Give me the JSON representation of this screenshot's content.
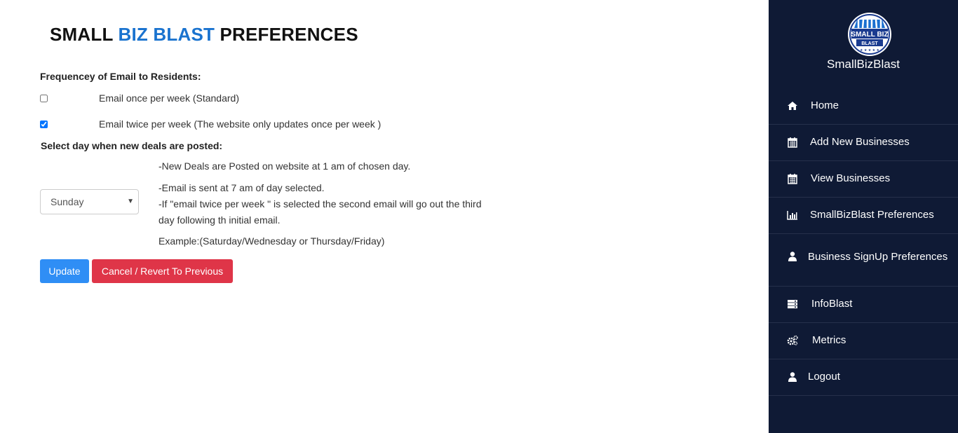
{
  "page": {
    "title_part1": "SMALL ",
    "title_accent": "BIZ BLAST",
    "title_part2": " PREFERENCES",
    "accent_color": "#1a73cf"
  },
  "frequency": {
    "label": "Frequencey of Email to Residents:",
    "options": [
      {
        "text": "Email once per week (Standard)",
        "checked": false
      },
      {
        "text": "Email twice per week (The website only updates once per week )",
        "checked": true
      }
    ]
  },
  "day": {
    "label": "Select day when new deals are posted:",
    "selected": "Sunday",
    "info": [
      "-New Deals are Posted on website at 1 am of chosen day.",
      "-Email is sent at 7 am of day selected.",
      "-If \"email twice per week \" is selected the second email will go out the third",
      "day following th initial email.",
      "Example:(Saturday/Wednesday or Thursday/Friday)"
    ]
  },
  "buttons": {
    "update": "Update",
    "cancel": "Cancel / Revert To Previous",
    "update_color": "#2f8ef5",
    "cancel_color": "#df3548"
  },
  "sidebar": {
    "brand": "SmallBizBlast",
    "logo_text_top": "SMALL BIZ",
    "logo_text_bottom": "BLAST",
    "background": "#0f1a35",
    "items": [
      {
        "label": "Home",
        "icon": "home-icon"
      },
      {
        "label": "Add New Businesses",
        "icon": "calendar-icon"
      },
      {
        "label": "View Businesses",
        "icon": "calendar-icon"
      },
      {
        "label": "SmallBizBlast Preferences",
        "icon": "bar-chart-icon"
      },
      {
        "label": "Business SignUp Preferences",
        "icon": "user-icon"
      },
      {
        "label": "InfoBlast",
        "icon": "server-icon"
      },
      {
        "label": "Metrics",
        "icon": "gears-icon"
      },
      {
        "label": "Logout",
        "icon": "user-icon"
      }
    ]
  }
}
